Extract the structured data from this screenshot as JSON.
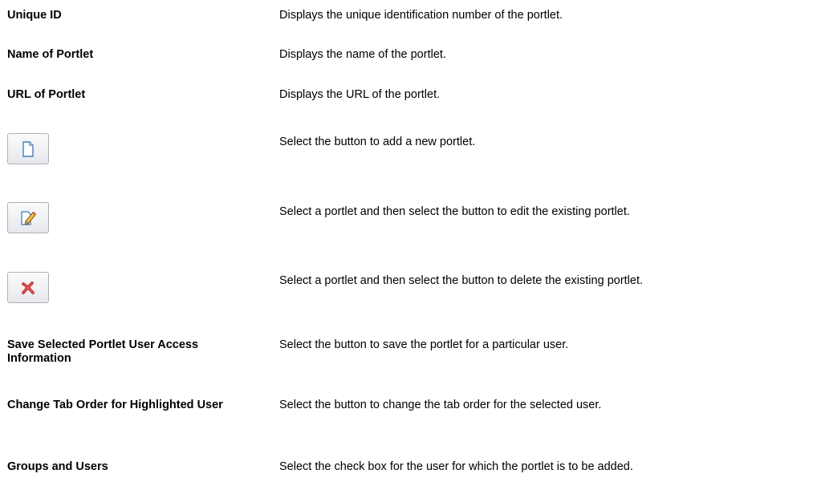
{
  "rows": [
    {
      "term": "Unique ID",
      "description": "Displays the unique identification number of the portlet."
    },
    {
      "term": "Name of Portlet",
      "description": "Displays the name of the portlet."
    },
    {
      "term": "URL of Portlet",
      "description": "Displays the URL of the portlet."
    },
    {
      "icon": "new-document-icon",
      "description": "Select the button to add a new portlet."
    },
    {
      "icon": "edit-pencil-icon",
      "description": "Select a portlet and then select the button to edit the existing portlet."
    },
    {
      "icon": "delete-x-icon",
      "description": "Select a portlet and then select the button to delete the existing portlet."
    },
    {
      "term": "Save Selected Portlet User Access Information",
      "description": "Select the button to save the portlet for a particular user."
    },
    {
      "term": "Change Tab Order for Highlighted User",
      "description": "Select the button to change the  tab order for the selected user."
    },
    {
      "term": "Groups and Users",
      "description": "Select the check box for  the user for which the portlet is to be added."
    }
  ]
}
